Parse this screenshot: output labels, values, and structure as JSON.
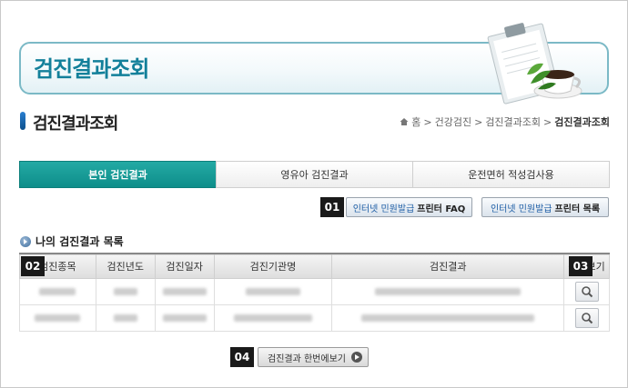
{
  "banner": {
    "title": "검진결과조회"
  },
  "page": {
    "title": "검진결과조회"
  },
  "breadcrumb": [
    "홈",
    "건강검진",
    "검진결과조회",
    "검진결과조회"
  ],
  "tabs": [
    {
      "label": "본인 검진결과",
      "active": true
    },
    {
      "label": "영유아 검진결과",
      "active": false
    },
    {
      "label": "운전면허 적성검사용",
      "active": false
    }
  ],
  "badges": {
    "b1": "01",
    "b2": "02",
    "b3": "03",
    "b4": "04"
  },
  "faq_button": {
    "highlight": "인터넷 민원발급",
    "label": "프린터 FAQ"
  },
  "list_button": {
    "highlight": "인터넷 민원발급",
    "label": "프린터 목록"
  },
  "section": {
    "title": "나의 검진결과 목록"
  },
  "table": {
    "columns": [
      "검진종목",
      "검진년도",
      "검진일자",
      "검진기관명",
      "검진결과",
      "상세보기"
    ]
  },
  "bottom_button": {
    "label": "검진결과 한번에보기"
  },
  "colors": {
    "accent": "#13809a",
    "tab_active": "#1a9e99"
  },
  "icons": {
    "home": "home-icon",
    "view": "magnifier-icon",
    "bullet": "circle-arrow-icon"
  }
}
